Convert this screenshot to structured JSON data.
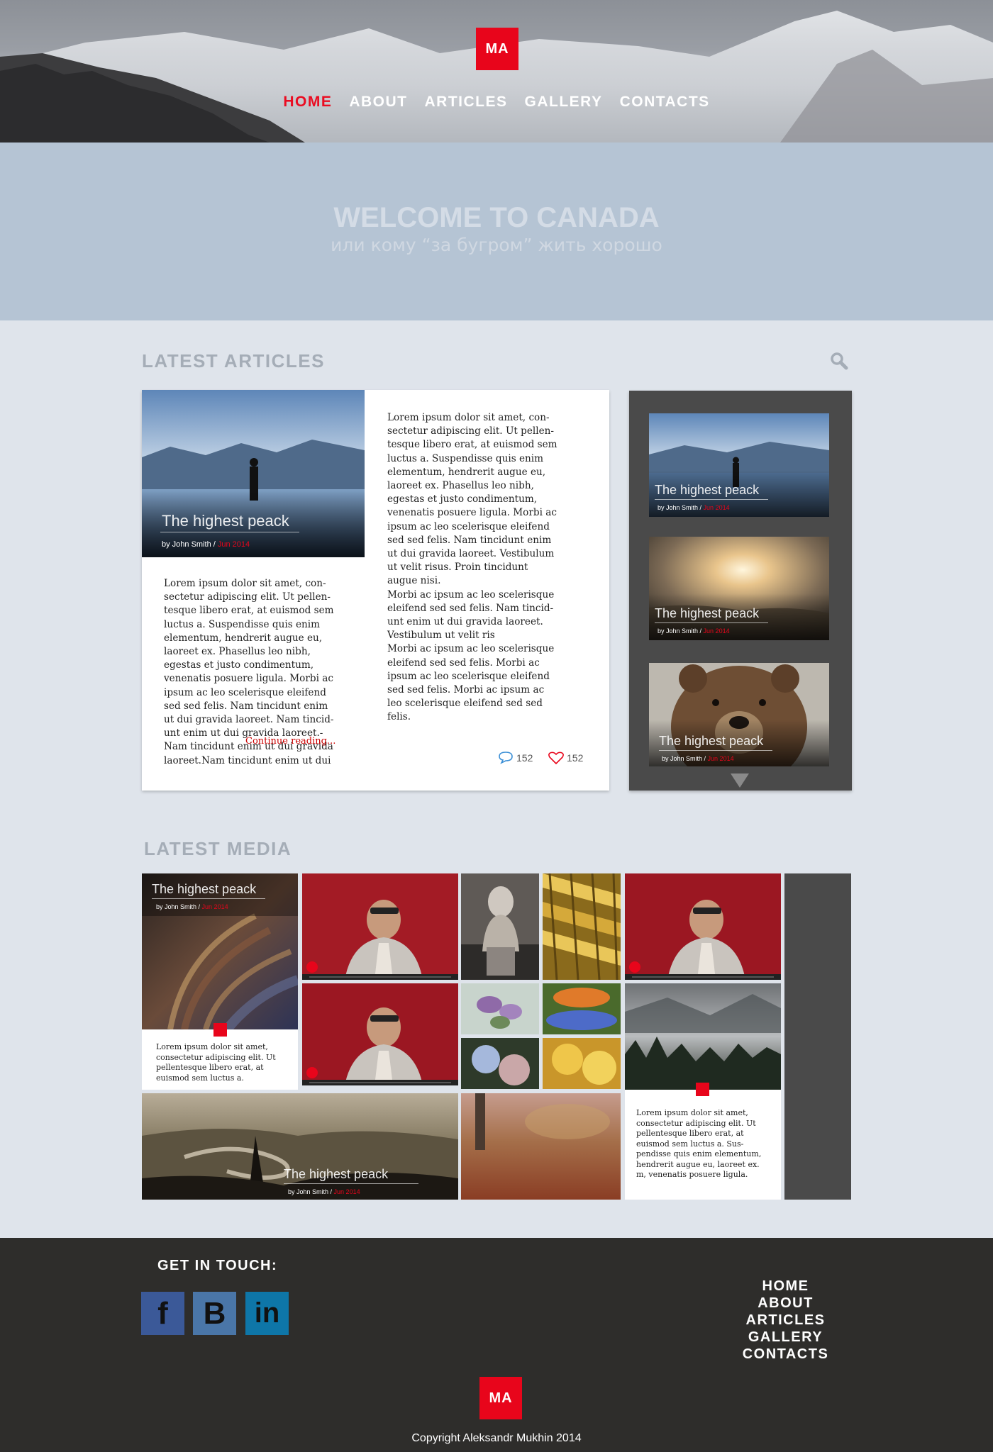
{
  "brand": {
    "logo_text": "MA",
    "accent": "#e8051b"
  },
  "nav": {
    "items": [
      "HOME",
      "ABOUT",
      "ARTICLES",
      "GALLERY",
      "CONTACTS"
    ],
    "active": "HOME"
  },
  "hero": {
    "title": "WELCOME TO CANADA",
    "subtitle": "или кому “за бугром” жить хорошо"
  },
  "latest_articles": {
    "title": "LATEST ARTICLES",
    "search_icon": "search-icon",
    "featured": {
      "caption_title": "The highest peack",
      "author": "by John Smith /",
      "date": "Jun 2014",
      "col1_text": "Lorem ipsum dolor sit amet, con-\nsectetur adipiscing elit. Ut pellen-\ntesque libero erat, at euismod sem\nluctus a. Suspendisse quis enim\nelementum, hendrerit augue eu,\nlaoreet ex. Phasellus leo nibh,\negestas et justo condimentum,\nvenenatis posuere ligula. Morbi ac\nipsum ac leo scelerisque eleifend\nsed sed felis. Nam tincidunt enim\nut dui gravida laoreet. Nam tincid-\nunt enim ut dui gravida laoreet.-\nNam tincidunt enim ut dui gravida\nlaoreet.Nam tincidunt enim ut dui",
      "col2_text": "Lorem ipsum dolor sit amet, con-\nsectetur adipiscing elit. Ut pellen-\ntesque libero erat, at euismod sem\nluctus a. Suspendisse quis enim\nelementum, hendrerit augue eu,\nlaoreet ex. Phasellus leo nibh,\negestas et justo condimentum,\nvenenatis posuere ligula. Morbi ac\nipsum ac leo scelerisque eleifend\nsed sed felis. Nam tincidunt enim\nut dui gravida laoreet. Vestibulum\nut velit risus. Proin tincidunt\naugue nisi.\nMorbi ac ipsum ac leo scelerisque\neleifend sed sed felis. Nam tincid-\nunt enim ut dui gravida laoreet.\nVestibulum ut velit ris\nMorbi ac ipsum ac leo scelerisque\neleifend sed sed felis. Morbi ac\nipsum ac leo scelerisque eleifend\nsed sed felis. Morbi ac ipsum ac\nleo scelerisque eleifend sed sed\nfelis.",
      "continue_label": "Continue reading...",
      "comments": "152",
      "likes": "152"
    },
    "sidebar": [
      {
        "title": "The highest peack",
        "author": "by John Smith /",
        "date": "Jun 2014"
      },
      {
        "title": "The highest peack",
        "author": "by John Smith /",
        "date": "Jun 2014"
      },
      {
        "title": "The highest peack",
        "author": "by John Smith /",
        "date": "Jun 2014"
      }
    ]
  },
  "latest_media": {
    "title": "LATEST MEDIA",
    "library_tile": {
      "title": "The highest peack",
      "author": "by John Smith /",
      "date": "Jun 2014",
      "text": "Lorem ipsum dolor sit amet,\nconsectetur adipiscing elit. Ut\npellentesque libero erat, at\neuismod sem luctus a."
    },
    "river_tile": {
      "title": "The highest peack",
      "author": "by John Smith /",
      "date": "Jun 2014"
    },
    "forest_tile": {
      "text": "Lorem ipsum dolor sit amet,\nconsectetur adipiscing elit. Ut\npellentesque libero erat, at\neuismod sem luctus a. Sus-\npendisse quis enim elementum,\nhendrerit augue eu, laoreet ex.\nm, venenatis posuere ligula."
    }
  },
  "footer": {
    "get_in_touch": "GET IN TOUCH:",
    "social": [
      {
        "letter": "f",
        "color": "#3b5998"
      },
      {
        "letter": "B",
        "color": "#4a76a8"
      },
      {
        "letter": "in",
        "color": "#0e76a8"
      }
    ],
    "nav": [
      "HOME",
      "ABOUT",
      "ARTICLES",
      "GALLERY",
      "CONTACTS"
    ],
    "copyright": "Copyright Aleksandr Mukhin 2014"
  }
}
